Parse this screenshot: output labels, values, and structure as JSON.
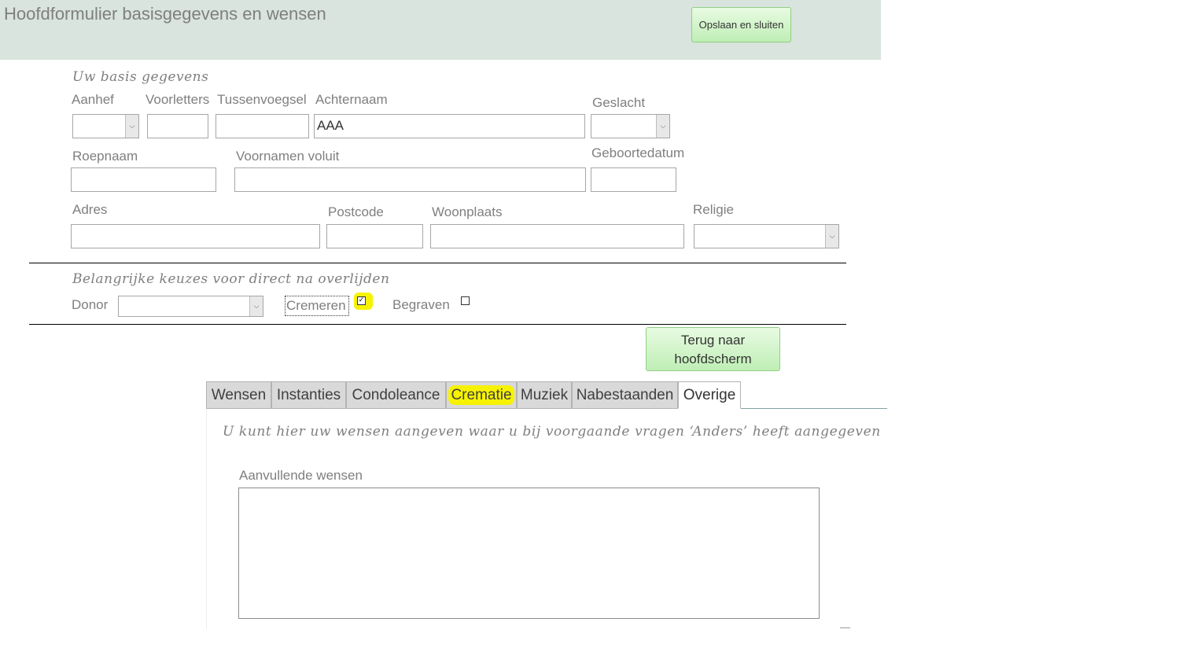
{
  "header": {
    "title": "Hoofdformulier basisgegevens en wensen",
    "save_label": "Opslaan en sluiten"
  },
  "basis": {
    "section_title": "Uw basis gegevens",
    "labels": {
      "aanhef": "Aanhef",
      "voorletters": "Voorletters",
      "tussenvoegsel": "Tussenvoegsel",
      "achternaam": "Achternaam",
      "geslacht": "Geslacht",
      "roepnaam": "Roepnaam",
      "voornamen": "Voornamen voluit",
      "geboortedatum": "Geboortedatum",
      "adres": "Adres",
      "postcode": "Postcode",
      "woonplaats": "Woonplaats",
      "religie": "Religie"
    },
    "values": {
      "aanhef": "",
      "voorletters": "",
      "tussenvoegsel": "",
      "achternaam": "AAA",
      "geslacht": "",
      "roepnaam": "",
      "voornamen": "",
      "geboortedatum": "",
      "adres": "",
      "postcode": "",
      "woonplaats": "",
      "religie": ""
    }
  },
  "keuzes": {
    "section_title": "Belangrijke keuzes voor direct na overlijden",
    "donor_label": "Donor",
    "donor_value": "",
    "cremeren_label": "Cremeren",
    "cremeren_checked": true,
    "begraven_label": "Begraven",
    "begraven_checked": false,
    "highlight_color": "#f7f300"
  },
  "back_button": {
    "line1": "Terug naar",
    "line2": "hoofdscherm"
  },
  "tabs": [
    {
      "label": "Wensen"
    },
    {
      "label": "Instanties"
    },
    {
      "label": "Condoleance"
    },
    {
      "label": "Crematie"
    },
    {
      "label": "Muziek"
    },
    {
      "label": "Nabestaanden"
    },
    {
      "label": "Overige"
    }
  ],
  "active_tab": "Overige",
  "overige": {
    "info_text": "U kunt hier uw wensen aangeven waar u bij voorgaande vragen ‘Anders’ heeft aangegeven",
    "aanvullende_label": "Aanvullende wensen",
    "aanvullende_value": ""
  },
  "colors": {
    "header_bg": "#d8e4dd",
    "button_green": "#bfeeb5",
    "highlight": "#f7f300"
  }
}
